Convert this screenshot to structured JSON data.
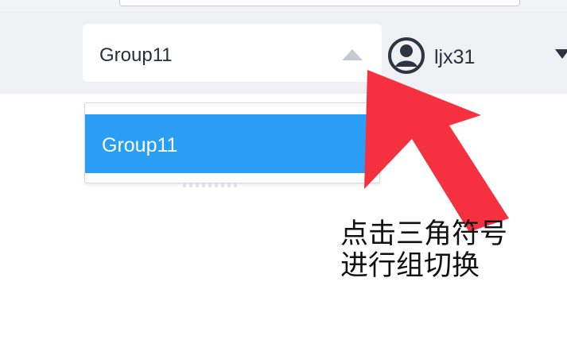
{
  "header": {
    "group_select": {
      "selected": "Group11",
      "icon": "caret-up-icon"
    },
    "user": {
      "avatar_icon": "user-avatar-icon",
      "name": "ljx31",
      "menu_icon": "caret-down-icon"
    }
  },
  "dropdown": {
    "options": [
      {
        "label": "Group11",
        "selected": true
      }
    ]
  },
  "annotation": {
    "line1": "点击三角符号",
    "line2": "进行组切换"
  },
  "colors": {
    "header_bg": "#eef0f4",
    "selected_option_bg": "#2a9df4",
    "arrow": "#f5303f",
    "caret": "#c3cad4"
  }
}
